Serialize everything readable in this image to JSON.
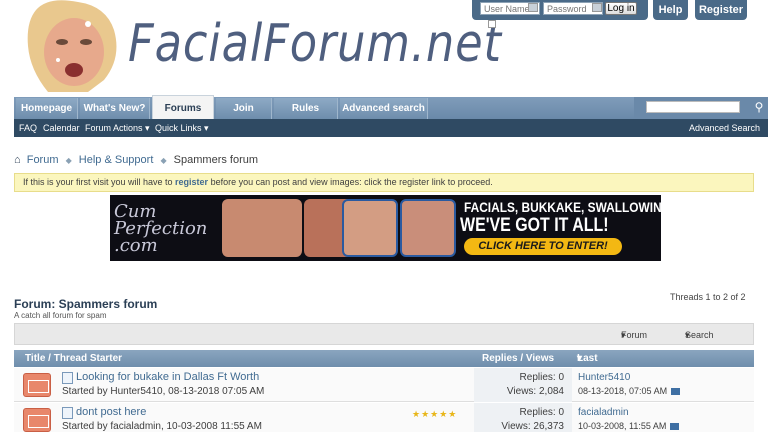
{
  "header": {
    "logo_text": "FacialForum.net",
    "login": {
      "username_placeholder": "User Name",
      "password_placeholder": "Password",
      "login_button": "Log in"
    },
    "help_button": "Help",
    "register_button": "Register"
  },
  "navbar": {
    "tabs": [
      "Homepage",
      "What's New?",
      "Forums",
      "Join",
      "Rules",
      "Advanced search"
    ],
    "active_tab": "Forums"
  },
  "subnav": {
    "items": [
      "FAQ",
      "Calendar",
      "Forum Actions ▾",
      "Quick Links ▾"
    ],
    "advanced_search": "Advanced Search"
  },
  "breadcrumb": {
    "items": [
      "Forum",
      "Help & Support",
      "Spammers forum"
    ]
  },
  "notice": {
    "before": "If this is your first visit you will have to ",
    "link": "register",
    "after": " before you can post and view images: click the register link to proceed."
  },
  "banner": {
    "logo": "Cum Perfection .com",
    "line1": "FACIALS, BUKKAKE, SWALLOWING,",
    "line2": "WE'VE GOT IT ALL!",
    "cta": "CLICK HERE TO ENTER!"
  },
  "forum": {
    "title": "Forum: Spammers forum",
    "description": "A catch all forum for spam",
    "threads_count": "Threads 1 to 2 of 2",
    "forum_tools": "Forum Tools",
    "search_forum": "Search Forum"
  },
  "table": {
    "col_title": "Title / Thread Starter",
    "col_stats": "Replies / Views",
    "col_lastpost": "Last Post By",
    "rows": [
      {
        "title": "Looking for bukake in Dallas Ft Worth",
        "starter": "Started by Hunter5410, 08-13-2018 07:05 AM",
        "replies": "Replies: 0",
        "views": "Views: 2,084",
        "last_user": "Hunter5410",
        "last_date": "08-13-2018, 07:05 AM",
        "rating": ""
      },
      {
        "title": "dont post here",
        "starter": "Started by facialadmin, 10-03-2008 11:55 AM",
        "replies": "Replies: 0",
        "views": "Views: 26,373",
        "last_user": "facialadmin",
        "last_date": "10-03-2008, 11:55 AM",
        "rating": "★★★★★"
      }
    ]
  },
  "colors": {
    "nav_blue": "#6f8eac",
    "dark_subnav": "#2f4a63",
    "link": "#416b91",
    "notice_bg": "#fbf6be",
    "banner_button": "#f3b813"
  }
}
